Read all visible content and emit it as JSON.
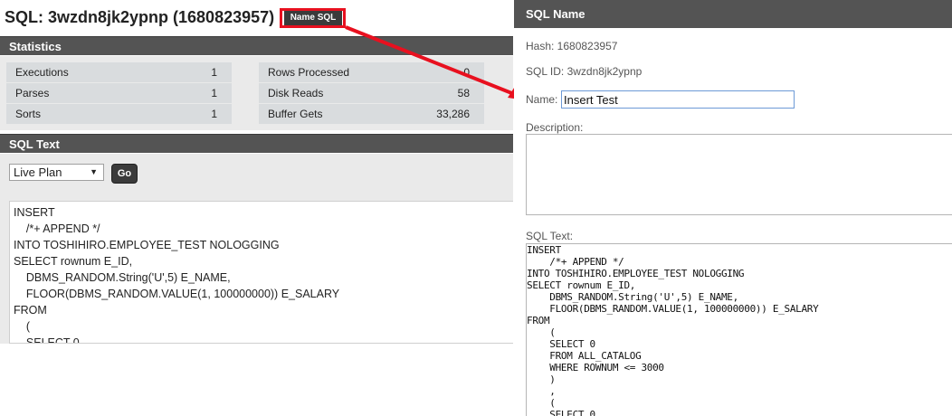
{
  "page": {
    "title": "SQL: 3wzdn8jk2ypnp (1680823957)",
    "name_sql_button": "Name SQL"
  },
  "statistics": {
    "header": "Statistics",
    "left": [
      {
        "label": "Executions",
        "value": "1"
      },
      {
        "label": "Parses",
        "value": "1"
      },
      {
        "label": "Sorts",
        "value": "1"
      }
    ],
    "right": [
      {
        "label": "Rows Processed",
        "value": "0"
      },
      {
        "label": "Disk Reads",
        "value": "58"
      },
      {
        "label": "Buffer Gets",
        "value": "33,286"
      }
    ]
  },
  "sql_text": {
    "header": "SQL Text",
    "plan_select_value": "Live Plan",
    "go_button": "Go",
    "code": "INSERT\n    /*+ APPEND */\nINTO TOSHIHIRO.EMPLOYEE_TEST NOLOGGING\nSELECT rownum E_ID,\n    DBMS_RANDOM.String('U',5) E_NAME,\n    FLOOR(DBMS_RANDOM.VALUE(1, 100000000)) E_SALARY\nFROM\n    (\n    SELECT 0"
  },
  "dialog": {
    "title": "SQL Name",
    "hash": "Hash: 1680823957",
    "sql_id": "SQL ID: 3wzdn8jk2ypnp",
    "name_label": "Name:",
    "name_value": "Insert Test",
    "description_label": "Description:",
    "description_value": "",
    "sql_text_label": "SQL Text:",
    "sql_text_code": "INSERT\n    /*+ APPEND */\nINTO TOSHIHIRO.EMPLOYEE_TEST NOLOGGING\nSELECT rownum E_ID,\n    DBMS_RANDOM.String('U',5) E_NAME,\n    FLOOR(DBMS_RANDOM.VALUE(1, 100000000)) E_SALARY\nFROM\n    (\n    SELECT 0\n    FROM ALL_CATALOG\n    WHERE ROWNUM <= 3000\n    )\n    ,\n    (\n    SELECT 0"
  },
  "colors": {
    "header_bg": "#545454",
    "highlight_red": "#e8101f",
    "stat_row_bg": "#d9dcde",
    "panel_bg": "#eaeaea"
  }
}
